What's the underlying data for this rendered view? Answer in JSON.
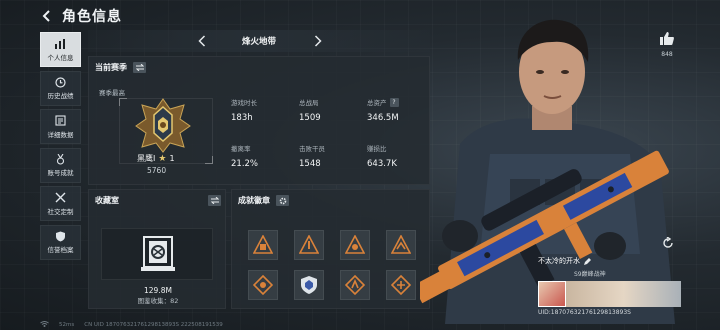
{
  "header": {
    "title": "角色信息"
  },
  "nav": {
    "items": [
      {
        "label": "个人信息",
        "icon": "bar-chart-icon",
        "active": true
      },
      {
        "label": "历史战绩",
        "icon": "clock-icon",
        "active": false
      },
      {
        "label": "详细数据",
        "icon": "document-icon",
        "active": false
      },
      {
        "label": "账号成就",
        "icon": "medal-icon",
        "active": false
      },
      {
        "label": "社交定制",
        "icon": "tools-icon",
        "active": false
      },
      {
        "label": "信誉档案",
        "icon": "shield-icon",
        "active": false
      }
    ]
  },
  "map_selector": {
    "current": "烽火地带"
  },
  "season": {
    "title": "当前赛季",
    "subtitle": "赛季最高",
    "rank_name": "黑鹰Ⅰ",
    "rank_stars": "1",
    "rank_score": "5760",
    "stats": [
      {
        "label": "游戏时长",
        "value": "183h"
      },
      {
        "label": "总战局",
        "value": "1509"
      },
      {
        "label": "总资产",
        "value": "346.5M",
        "help": "?"
      },
      {
        "label": "撤离率",
        "value": "21.2%"
      },
      {
        "label": "击败干员",
        "value": "1548"
      },
      {
        "label": "赚损比",
        "value": "643.7K"
      }
    ]
  },
  "collection": {
    "title": "收藏室",
    "value": "129.8M",
    "count_label": "图鉴收集：82"
  },
  "achievements": {
    "title": "成就徽章"
  },
  "likes": {
    "count": "848"
  },
  "player": {
    "name": "不太冷的开水",
    "guild": "S9巅峰战神",
    "uid": "UID:18707632176129813893S"
  },
  "status_bar": {
    "signal": "52ms",
    "build": "CN UID 18707632176129813893S 222508191539"
  },
  "colors": {
    "accent_gold": "#e3c770",
    "active_tab": "#d9dde0",
    "badge_orange": "#d9823a"
  }
}
